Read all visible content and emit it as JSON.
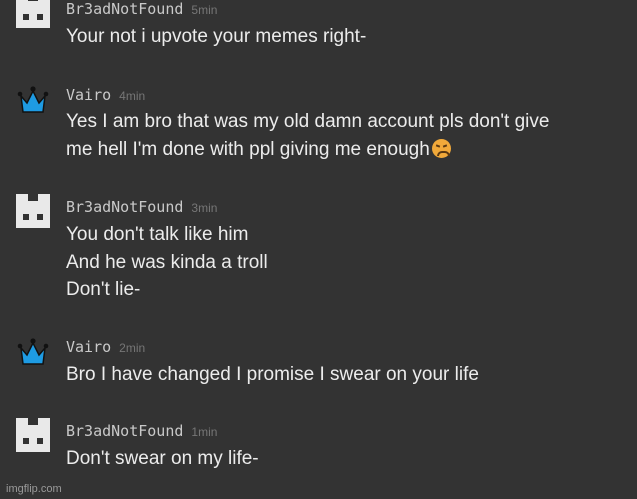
{
  "messages": [
    {
      "avatar": "ghost-block-icon",
      "username": "Br3adNotFound",
      "time": "5min",
      "lines": [
        "Your not i upvote your memes right-"
      ]
    },
    {
      "avatar": "crown-icon",
      "username": "Vairo",
      "time": "4min",
      "lines": [
        "Yes I am bro that was my old damn account pls don't give",
        "me hell I'm done with ppl giving me enough"
      ],
      "emoji": "confounded-face-emoji"
    },
    {
      "avatar": "ghost-block-icon",
      "username": "Br3adNotFound",
      "time": "3min",
      "lines": [
        "You don't talk like him",
        "And he was kinda a troll",
        "Don't lie-"
      ]
    },
    {
      "avatar": "crown-icon",
      "username": "Vairo",
      "time": "2min",
      "lines": [
        "Bro I have changed I promise I swear on your life"
      ]
    },
    {
      "avatar": "ghost-block-icon",
      "username": "Br3adNotFound",
      "time": "1min",
      "lines": [
        "Don't swear on my life-"
      ]
    }
  ],
  "watermark": "imgflip.com",
  "colors": {
    "background": "#333333",
    "text": "#ececec",
    "username": "#c9c9c9",
    "time": "#767676",
    "crown": "#1e9be3"
  }
}
